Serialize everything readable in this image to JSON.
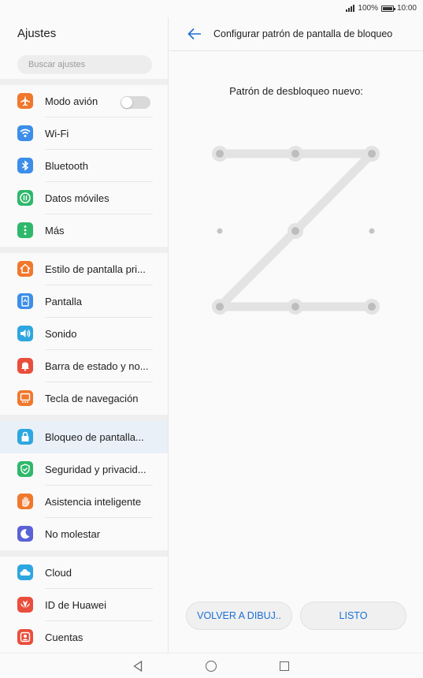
{
  "status_bar": {
    "battery": "100%",
    "time": "10:00"
  },
  "settings": {
    "title": "Ajustes",
    "search_placeholder": "Buscar ajustes",
    "items": [
      {
        "label": "Modo avión",
        "icon": "airplane-icon",
        "color": "#f0782d"
      },
      {
        "label": "Wi-Fi",
        "icon": "wifi-icon",
        "color": "#3c8ee8"
      },
      {
        "label": "Bluetooth",
        "icon": "bluetooth-icon",
        "color": "#3c8ee8"
      },
      {
        "label": "Datos móviles",
        "icon": "mobile-data-icon",
        "color": "#2fb86b"
      },
      {
        "label": "Más",
        "icon": "more-icon",
        "color": "#2fb86b"
      },
      {
        "label": "Estilo de pantalla pri...",
        "icon": "home-style-icon",
        "color": "#f0782d"
      },
      {
        "label": "Pantalla",
        "icon": "display-icon",
        "color": "#3c8ee8"
      },
      {
        "label": "Sonido",
        "icon": "sound-icon",
        "color": "#2ea6e0"
      },
      {
        "label": "Barra de estado y no...",
        "icon": "notification-icon",
        "color": "#e94e3c"
      },
      {
        "label": "Tecla de navegación",
        "icon": "navigation-key-icon",
        "color": "#f0782d"
      },
      {
        "label": "Bloqueo de pantalla...",
        "icon": "lock-icon",
        "color": "#2ea6e0"
      },
      {
        "label": "Seguridad y privacid...",
        "icon": "shield-icon",
        "color": "#2fb86b"
      },
      {
        "label": "Asistencia inteligente",
        "icon": "hand-icon",
        "color": "#f0782d"
      },
      {
        "label": "No molestar",
        "icon": "moon-icon",
        "color": "#5b62d6"
      },
      {
        "label": "Cloud",
        "icon": "cloud-icon",
        "color": "#2ea6e0"
      },
      {
        "label": "ID de Huawei",
        "icon": "huawei-icon",
        "color": "#e94e3c"
      },
      {
        "label": "Cuentas",
        "icon": "account-icon",
        "color": "#e94e3c"
      }
    ]
  },
  "pattern_screen": {
    "title": "Configurar patrón de pantalla de bloqueo",
    "prompt": "Patrón de desbloqueo nuevo:",
    "pattern_sequence": [
      1,
      2,
      3,
      5,
      7,
      8,
      9
    ],
    "redraw_button": "VOLVER A DIBUJ..",
    "done_button": "LISTO",
    "accent_color": "#1a6fd4"
  }
}
